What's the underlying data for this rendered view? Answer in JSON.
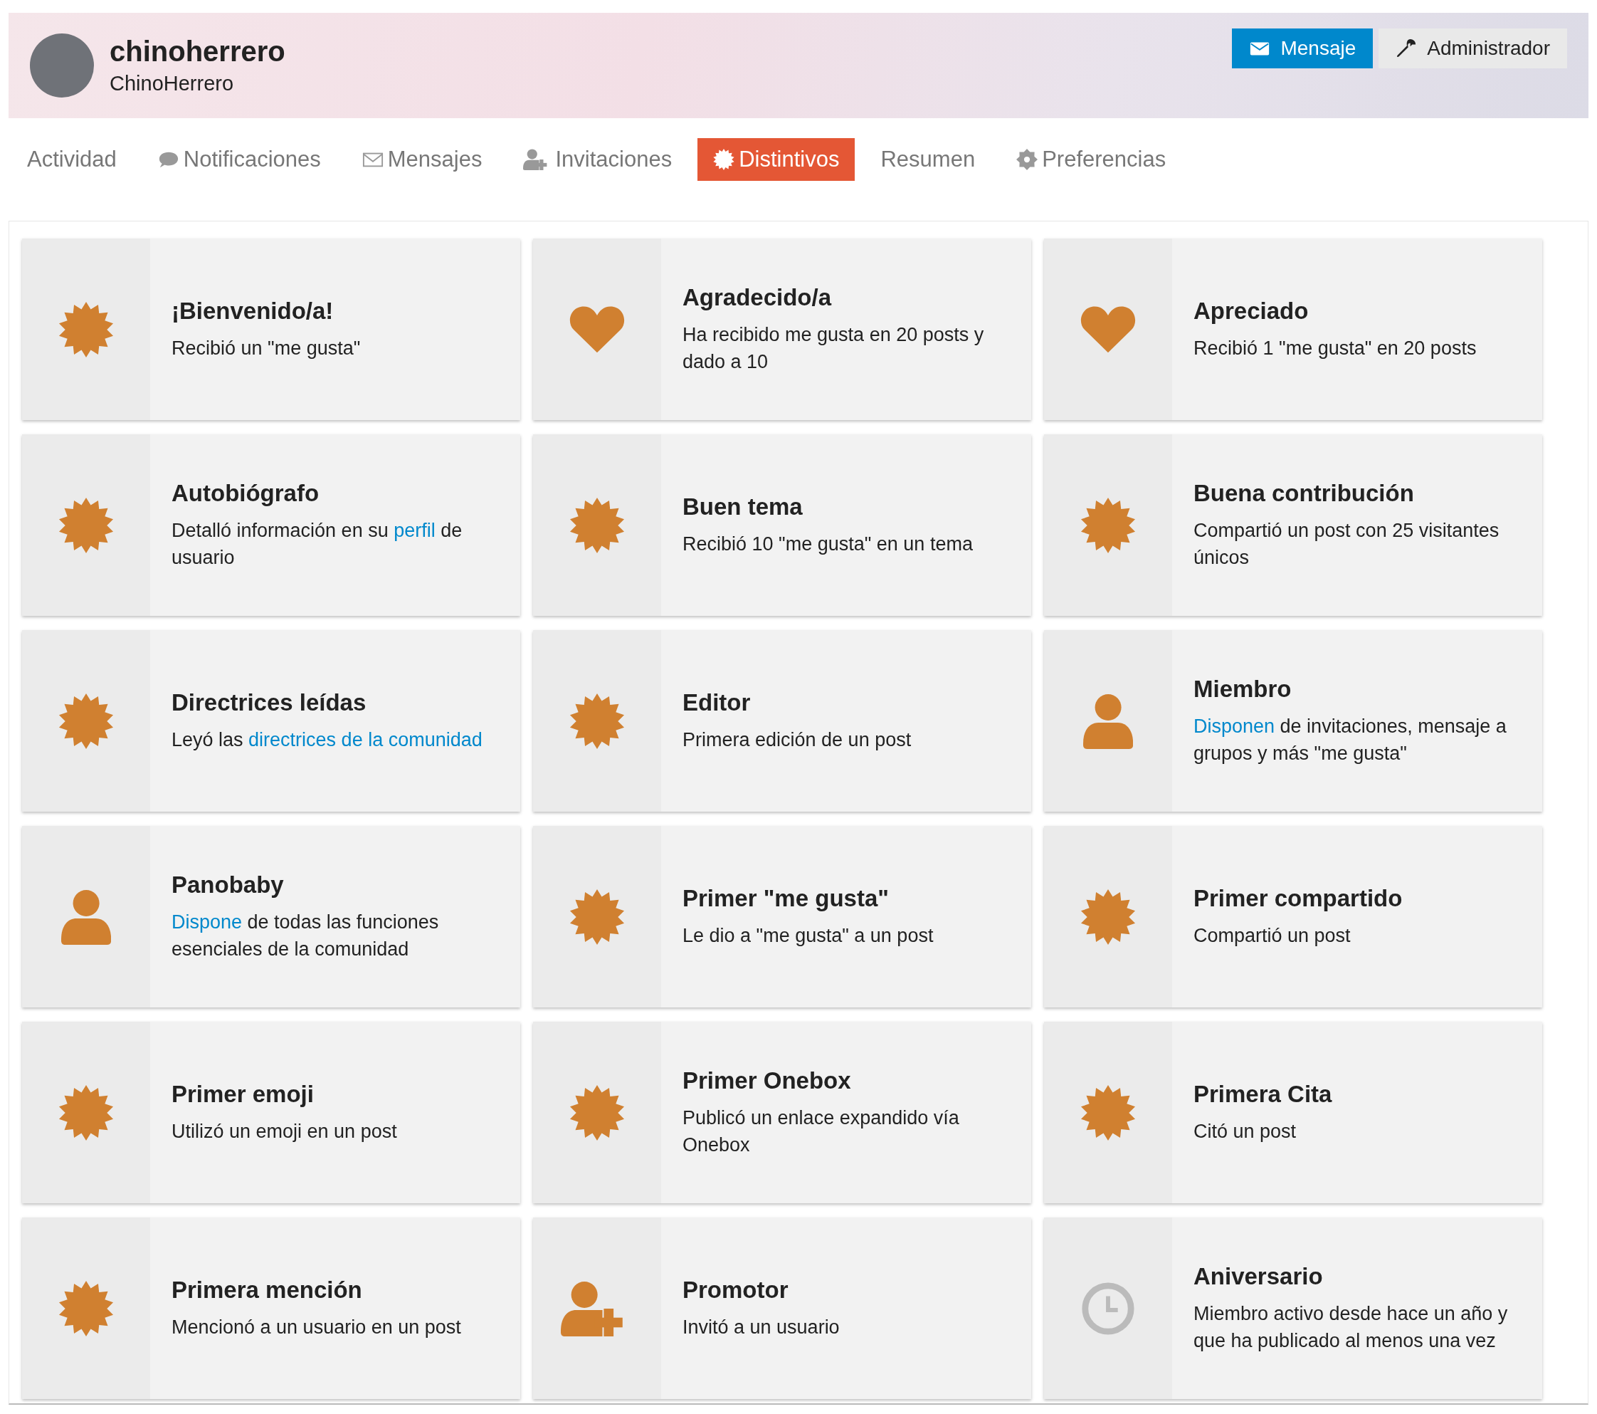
{
  "profile": {
    "username": "chinoherrero",
    "name": "ChinoHerrero"
  },
  "actions": [
    {
      "kind": "message",
      "label": "Mensaje"
    },
    {
      "kind": "admin",
      "label": "Administrador"
    }
  ],
  "tabs": [
    {
      "label": "Actividad",
      "kind": "plain",
      "selected": false
    },
    {
      "label": "Notificaciones",
      "kind": "comment",
      "selected": false
    },
    {
      "label": "Mensajes",
      "kind": "envelope",
      "selected": false
    },
    {
      "label": "Invitaciones",
      "kind": "user-plus",
      "selected": false
    },
    {
      "label": "Distintivos",
      "kind": "burst",
      "selected": true
    },
    {
      "label": "Resumen",
      "kind": "plain",
      "selected": false
    },
    {
      "label": "Preferencias",
      "kind": "gear",
      "selected": false
    }
  ],
  "badges": [
    {
      "kind": "burst",
      "earned": true,
      "title": "¡Bienvenido/a!",
      "description": [
        {
          "kind": "text",
          "text": "Recibió un \"me gusta\""
        }
      ]
    },
    {
      "kind": "heart",
      "earned": true,
      "title": "Agradecido/a",
      "description": [
        {
          "kind": "text",
          "text": "Ha recibido me gusta en 20 posts y dado a 10"
        }
      ]
    },
    {
      "kind": "heart",
      "earned": true,
      "title": "Apreciado",
      "description": [
        {
          "kind": "text",
          "text": "Recibió 1 \"me gusta\" en 20 posts"
        }
      ]
    },
    {
      "kind": "burst",
      "earned": true,
      "title": "Autobiógrafo",
      "description": [
        {
          "kind": "text",
          "text": "Detalló información en su "
        },
        {
          "kind": "link",
          "text": "perfil"
        },
        {
          "kind": "text",
          "text": " de usuario"
        }
      ]
    },
    {
      "kind": "burst",
      "earned": true,
      "title": "Buen tema",
      "description": [
        {
          "kind": "text",
          "text": "Recibió 10 \"me gusta\" en un tema"
        }
      ]
    },
    {
      "kind": "burst",
      "earned": true,
      "title": "Buena contribución",
      "description": [
        {
          "kind": "text",
          "text": "Compartió un post con 25 visitantes únicos"
        }
      ]
    },
    {
      "kind": "burst",
      "earned": true,
      "title": "Directrices leídas",
      "description": [
        {
          "kind": "text",
          "text": "Leyó las "
        },
        {
          "kind": "link",
          "text": "directrices de la comunidad"
        }
      ]
    },
    {
      "kind": "burst",
      "earned": true,
      "title": "Editor",
      "description": [
        {
          "kind": "text",
          "text": "Primera edición de un post"
        }
      ]
    },
    {
      "kind": "user",
      "earned": true,
      "title": "Miembro",
      "description": [
        {
          "kind": "link",
          "text": "Disponen"
        },
        {
          "kind": "text",
          "text": " de invitaciones, mensaje a grupos y más \"me gusta\""
        }
      ]
    },
    {
      "kind": "user",
      "earned": true,
      "title": "Panobaby",
      "description": [
        {
          "kind": "link",
          "text": "Dispone"
        },
        {
          "kind": "text",
          "text": " de todas las funciones esenciales de la comunidad"
        }
      ]
    },
    {
      "kind": "burst",
      "earned": true,
      "title": "Primer \"me gusta\"",
      "description": [
        {
          "kind": "text",
          "text": "Le dio a \"me gusta\" a un post"
        }
      ]
    },
    {
      "kind": "burst",
      "earned": true,
      "title": "Primer compartido",
      "description": [
        {
          "kind": "text",
          "text": "Compartió un post"
        }
      ]
    },
    {
      "kind": "burst",
      "earned": true,
      "title": "Primer emoji",
      "description": [
        {
          "kind": "text",
          "text": "Utilizó un emoji en un post"
        }
      ]
    },
    {
      "kind": "burst",
      "earned": true,
      "title": "Primer Onebox",
      "description": [
        {
          "kind": "text",
          "text": "Publicó un enlace expandido vía Onebox"
        }
      ]
    },
    {
      "kind": "burst",
      "earned": true,
      "title": "Primera Cita",
      "description": [
        {
          "kind": "text",
          "text": "Citó un post"
        }
      ]
    },
    {
      "kind": "burst",
      "earned": true,
      "title": "Primera mención",
      "description": [
        {
          "kind": "text",
          "text": "Mencionó a un usuario en un post"
        }
      ]
    },
    {
      "kind": "user-plus",
      "earned": true,
      "title": "Promotor",
      "description": [
        {
          "kind": "text",
          "text": "Invitó a un usuario"
        }
      ]
    },
    {
      "kind": "clock",
      "earned": false,
      "title": "Aniversario",
      "description": [
        {
          "kind": "text",
          "text": "Miembro activo desde hace un año y que ha publicado al menos una vez"
        }
      ]
    }
  ]
}
